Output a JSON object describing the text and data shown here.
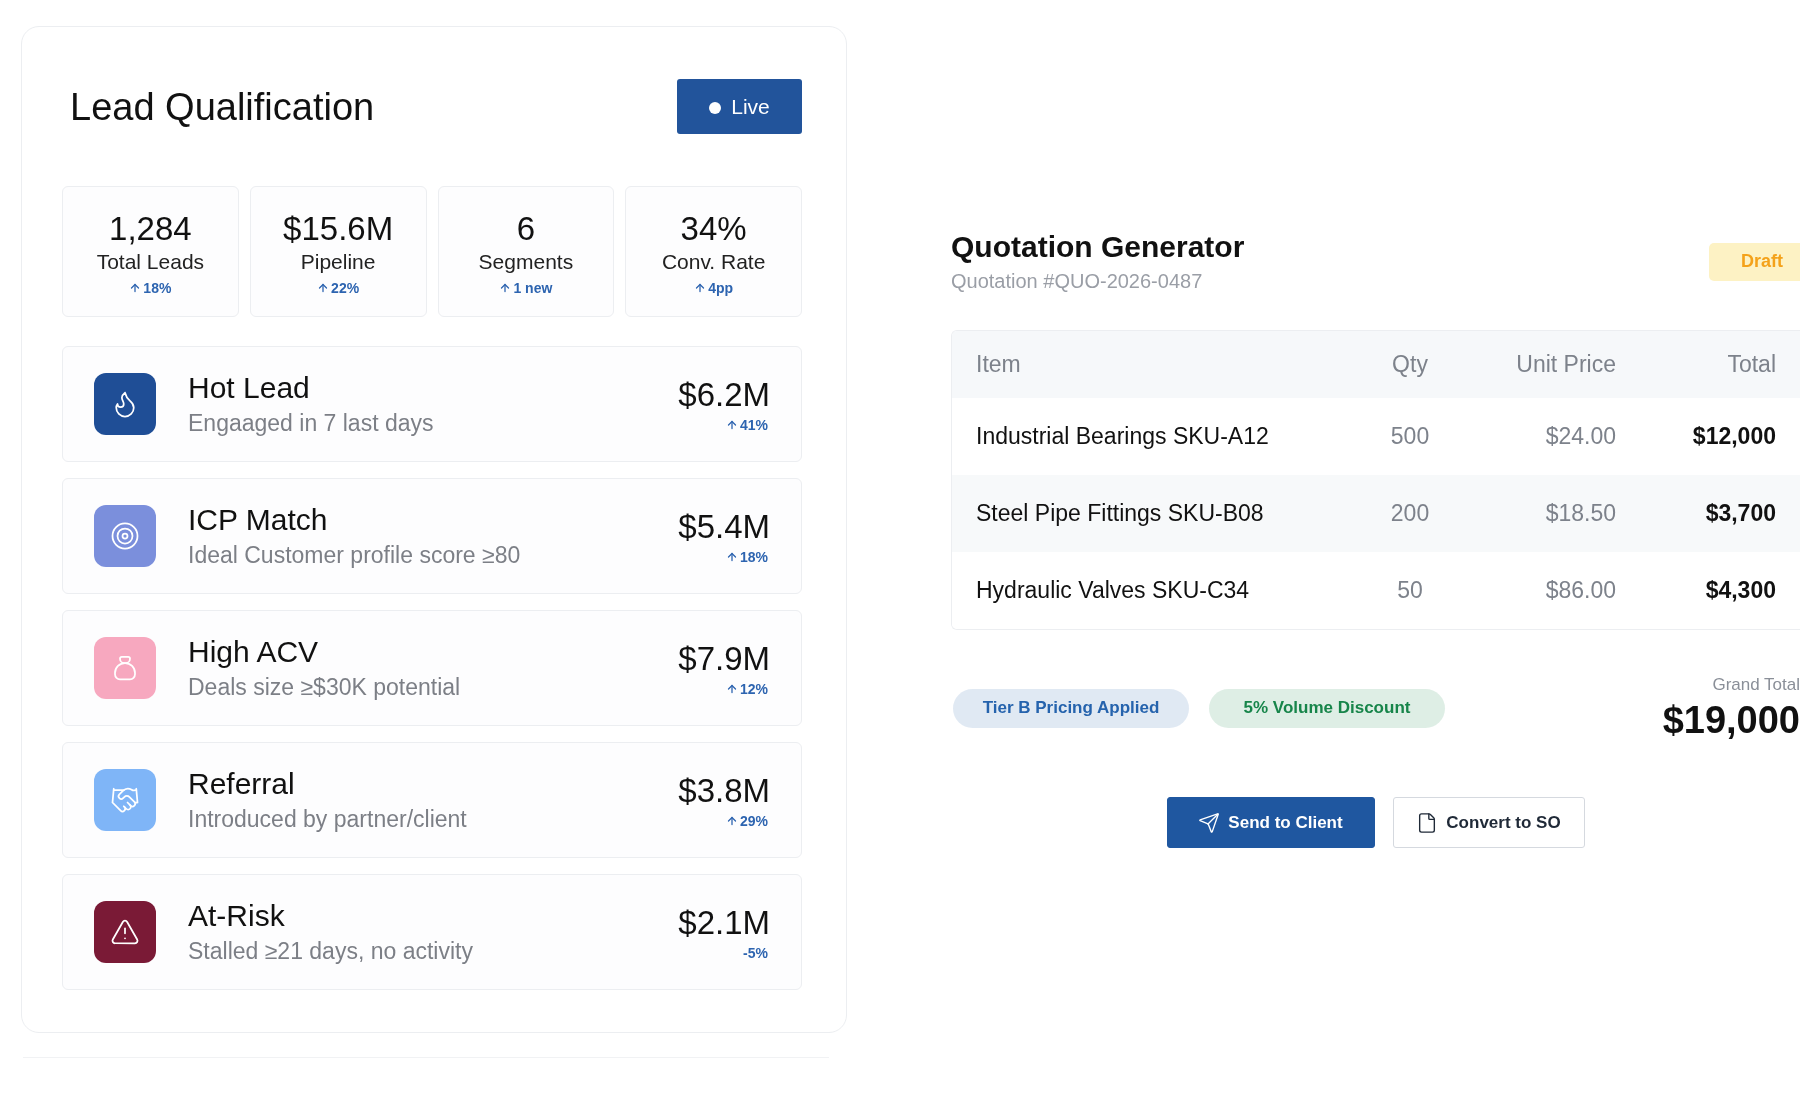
{
  "lead_qualification": {
    "title": "Lead Qualification",
    "live_badge": {
      "label": "Live"
    },
    "stats": [
      {
        "value": "1,284",
        "label": "Total Leads",
        "change": "18%",
        "up": true
      },
      {
        "value": "$15.6M",
        "label": "Pipeline",
        "change": "22%",
        "up": true
      },
      {
        "value": "6",
        "label": "Segments",
        "change": "1 new",
        "up": true
      },
      {
        "value": "34%",
        "label": "Conv. Rate",
        "change": "4pp",
        "up": true
      }
    ],
    "segments": [
      {
        "title": "Hot Lead",
        "subtitle": "Engaaged in 7 last days",
        "color": "#1f4e96",
        "value": "$6.2M",
        "change": "41%",
        "up": true
      },
      {
        "title": "ICP Match",
        "subtitle": "Ideal Customer profile score ≥80",
        "color": "#7b8fdc",
        "value": "$5.4M",
        "change": "18%",
        "up": true
      },
      {
        "title": "High ACV",
        "subtitle": "Deals size ≥$30K potential",
        "color": "#f7a8bf",
        "value": "$7.9M",
        "change": "12%",
        "up": true
      },
      {
        "title": "Referral",
        "subtitle": "Introduced by partner/client",
        "color": "#7fb5f7",
        "value": "$3.8M",
        "change": "29%",
        "up": true
      },
      {
        "title": "At-Risk",
        "subtitle": "Stalled ≥21 days, no activity",
        "color": "#7a1a36",
        "value": "$2.1M",
        "change": "-5%",
        "up": false
      }
    ]
  },
  "quotation": {
    "title": "Quotation Generator",
    "number": "Quotation #QUO-2026-0487",
    "status": "Draft",
    "table": {
      "columns": [
        "Item",
        "Qty",
        "Unit Price",
        "Total"
      ],
      "rows": [
        {
          "item": "Industrial Bearings SKU-A12",
          "qty": "500",
          "unit_price": "$24.00",
          "total": "$12,000"
        },
        {
          "item": "Steel Pipe Fittings SKU-B08",
          "qty": "200",
          "unit_price": "$18.50",
          "total": "$3,700"
        },
        {
          "item": "Hydraulic Valves SKU-C34",
          "qty": "50",
          "unit_price": "$86.00",
          "total": "$4,300"
        }
      ]
    },
    "tags": [
      {
        "label": "Tier B Pricing Applied",
        "color": "#2563ad"
      },
      {
        "label": "5% Volume Discount",
        "color": "#17854a"
      }
    ],
    "grand_total": {
      "label": "Grand Total",
      "value": "$19,000"
    },
    "actions": [
      {
        "label": "Send to Client",
        "kind": "primary"
      },
      {
        "label": "Convert to SO",
        "kind": "secondary"
      }
    ]
  }
}
